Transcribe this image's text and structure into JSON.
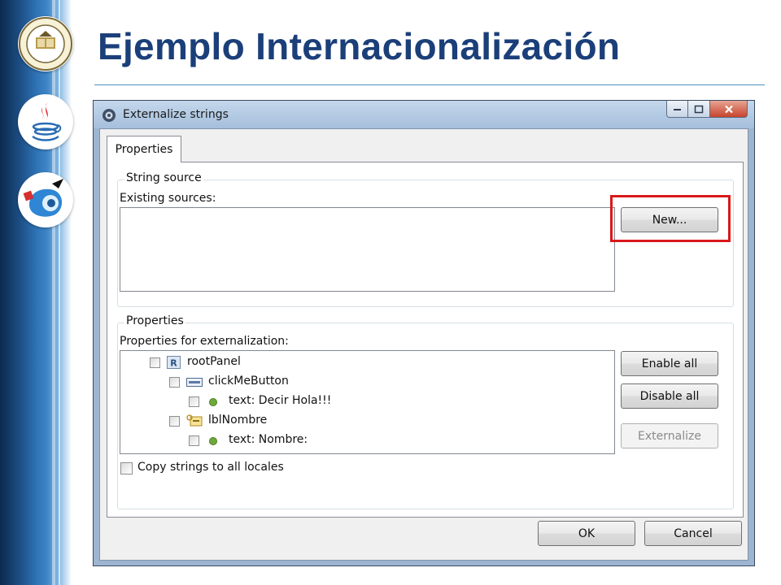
{
  "slide": {
    "title": "Ejemplo Internacionalización"
  },
  "colors": {
    "title": "#1b3f79",
    "highlight": "#d9181b",
    "bullet_green": "#6fa93b"
  },
  "dialog": {
    "window_title": "Externalize strings",
    "window_buttons": {
      "minimize_icon": "minimize-icon",
      "maximize_icon": "maximize-icon",
      "close_icon": "close-icon"
    },
    "tab_label": "Properties",
    "string_source": {
      "group_label": "String source",
      "existing_label": "Existing sources:",
      "new_button": "New..."
    },
    "properties": {
      "group_label": "Properties",
      "for_label": "Properties for externalization:",
      "tree": [
        {
          "label": "rootPanel",
          "icon": "root-panel-icon"
        },
        {
          "label": "clickMeButton",
          "icon": "button-component-icon"
        },
        {
          "label": "text: Decir Hola!!!",
          "icon": "green-dot-icon"
        },
        {
          "label": "lblNombre",
          "icon": "label-component-icon"
        },
        {
          "label": "text: Nombre:",
          "icon": "green-dot-icon"
        }
      ],
      "enable_all": "Enable all",
      "disable_all": "Disable all",
      "externalize": "Externalize",
      "copy_strings_label": "Copy strings to all locales"
    },
    "ok_button": "OK",
    "cancel_button": "Cancel"
  }
}
